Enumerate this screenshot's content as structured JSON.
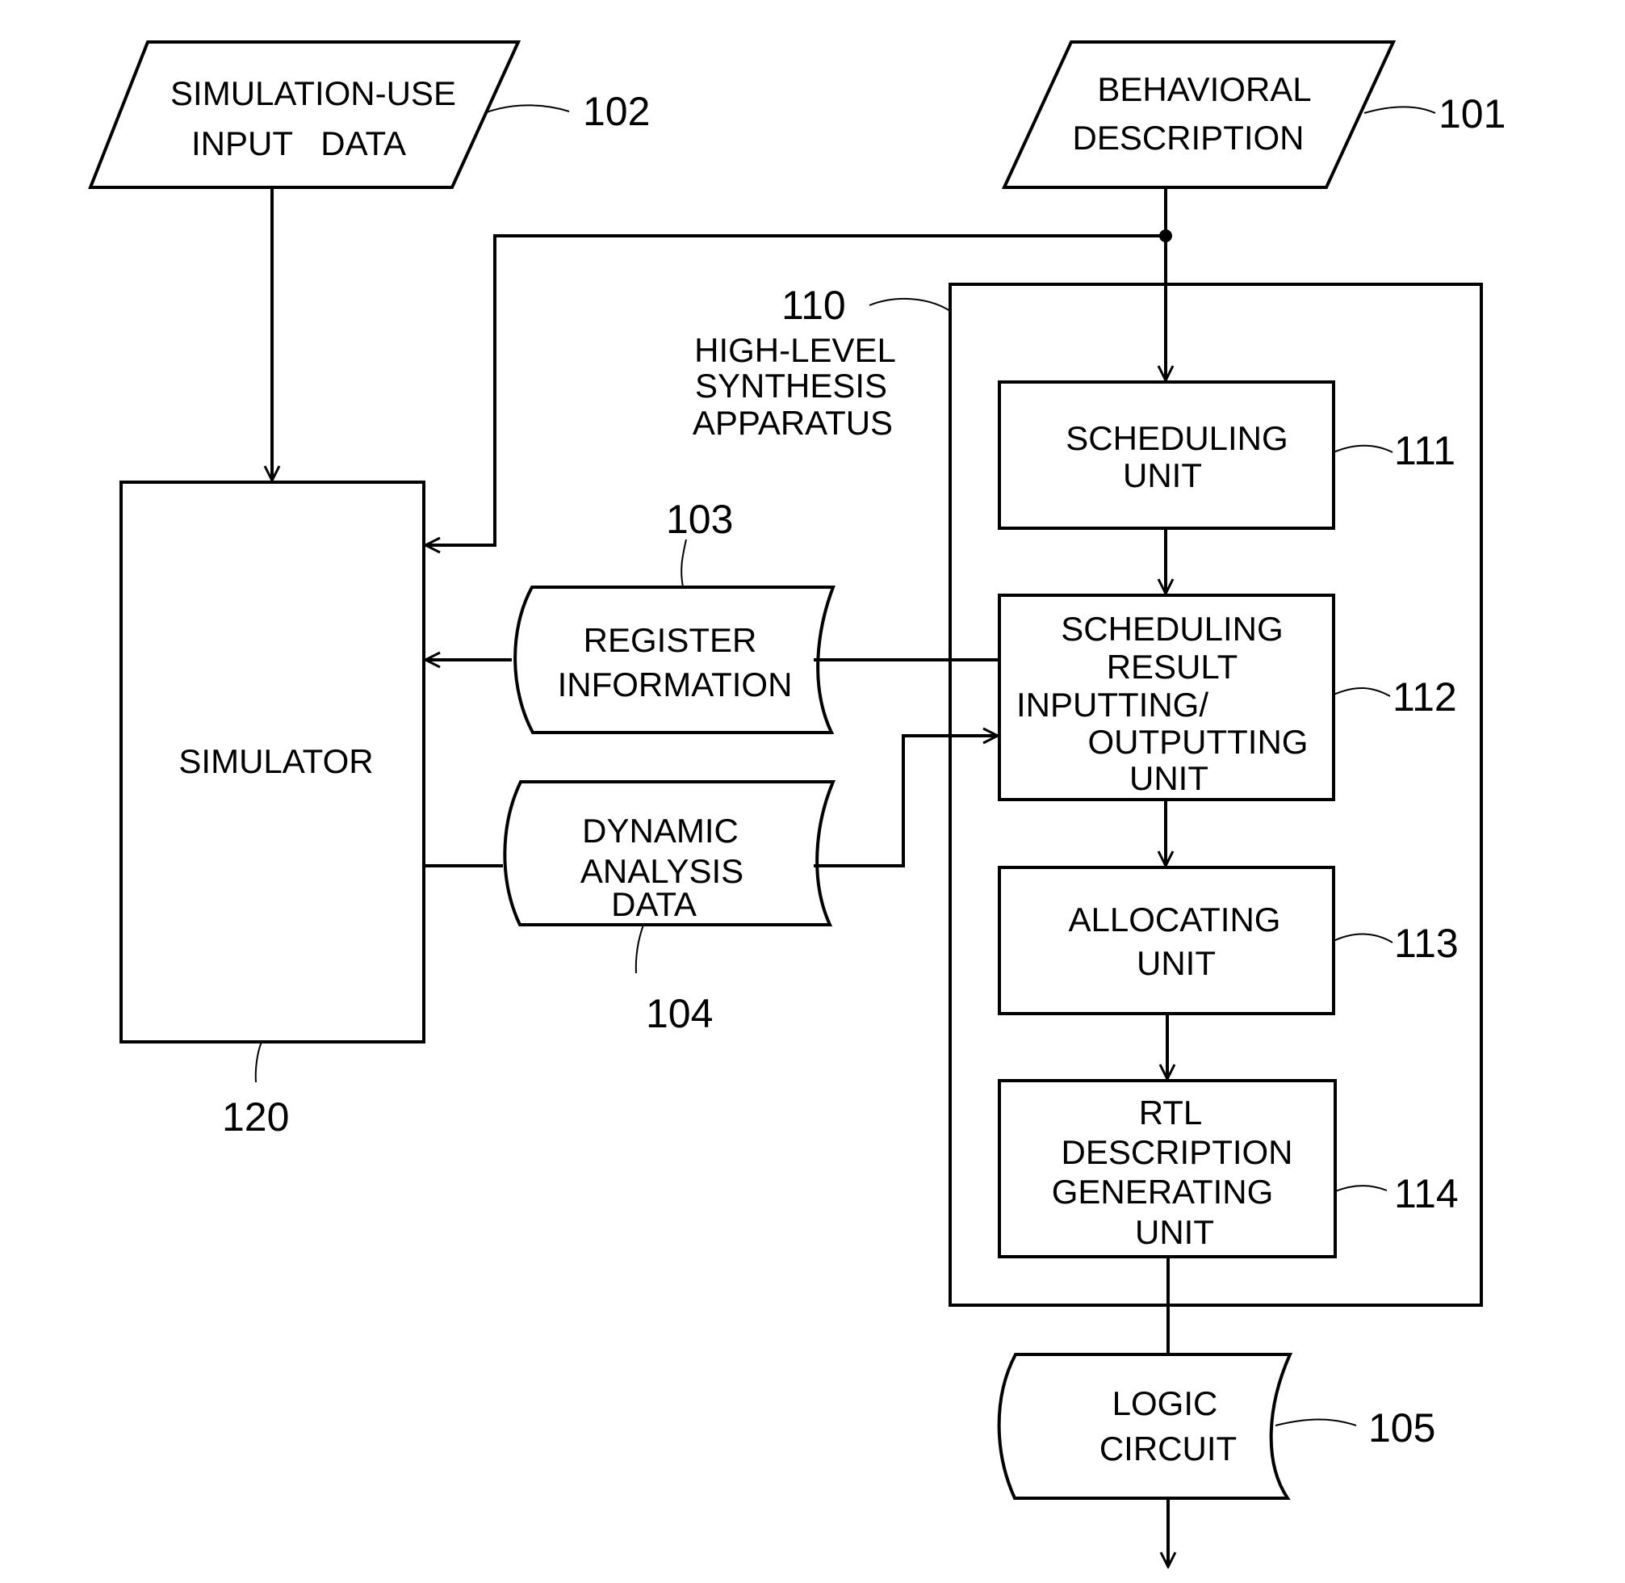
{
  "nodes": {
    "sim_input": {
      "ref": "102",
      "lines": [
        "SIMULATION-USE",
        "INPUT   DATA"
      ]
    },
    "behavioral": {
      "ref": "101",
      "lines": [
        "BEHAVIORAL",
        "DESCRIPTION"
      ]
    },
    "apparatus": {
      "ref": "110",
      "lines": [
        "HIGH-LEVEL",
        "SYNTHESIS",
        "APPARATUS"
      ]
    },
    "scheduling": {
      "ref": "111",
      "lines": [
        "SCHEDULING",
        "UNIT"
      ]
    },
    "srio": {
      "ref": "112",
      "lines": [
        "SCHEDULING",
        "RESULT",
        "INPUTTING/",
        "OUTPUTTING",
        "UNIT"
      ]
    },
    "allocating": {
      "ref": "113",
      "lines": [
        "ALLOCATING",
        "UNIT"
      ]
    },
    "rtl": {
      "ref": "114",
      "lines": [
        "RTL",
        "DESCRIPTION",
        "GENERATING",
        "UNIT"
      ]
    },
    "register": {
      "ref": "103",
      "lines": [
        "REGISTER",
        "INFORMATION"
      ]
    },
    "dynamic": {
      "ref": "104",
      "lines": [
        "DYNAMIC",
        "ANALYSIS",
        "DATA"
      ]
    },
    "simulator": {
      "ref": "120",
      "lines": [
        "SIMULATOR"
      ]
    },
    "logic": {
      "ref": "105",
      "lines": [
        "LOGIC",
        "CIRCUIT"
      ]
    }
  }
}
